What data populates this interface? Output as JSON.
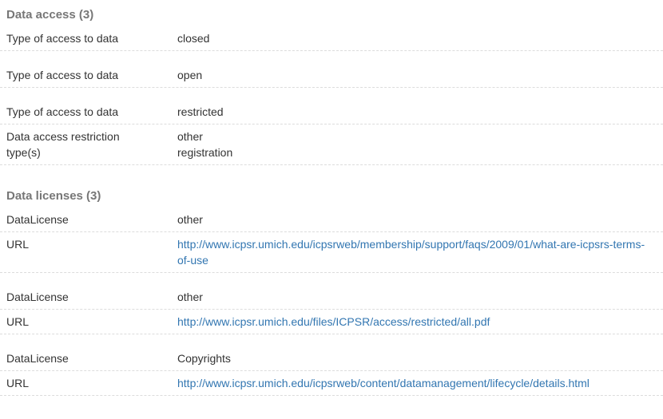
{
  "data_access": {
    "heading": "Data access (3)",
    "rows": [
      {
        "label": "Type of access to data",
        "value": "closed"
      },
      {
        "label": "Type of access to data",
        "value": "open"
      },
      {
        "label": "Type of access to data",
        "value": "restricted"
      },
      {
        "label": "Data access restriction type(s)",
        "values": [
          "other",
          "registration"
        ]
      }
    ]
  },
  "data_licenses": {
    "heading": "Data licenses (3)",
    "rows": [
      {
        "label": "DataLicense",
        "value": "other"
      },
      {
        "label": "URL",
        "value": "http://www.icpsr.umich.edu/icpsrweb/membership/support/faqs/2009/01/what-are-icpsrs-terms-of-use"
      },
      {
        "label": "DataLicense",
        "value": "other"
      },
      {
        "label": "URL",
        "value": "http://www.icpsr.umich.edu/files/ICPSR/access/restricted/all.pdf"
      },
      {
        "label": "DataLicense",
        "value": "Copyrights"
      },
      {
        "label": "URL",
        "value": "http://www.icpsr.umich.edu/icpsrweb/content/datamanagement/lifecycle/details.html"
      }
    ]
  }
}
